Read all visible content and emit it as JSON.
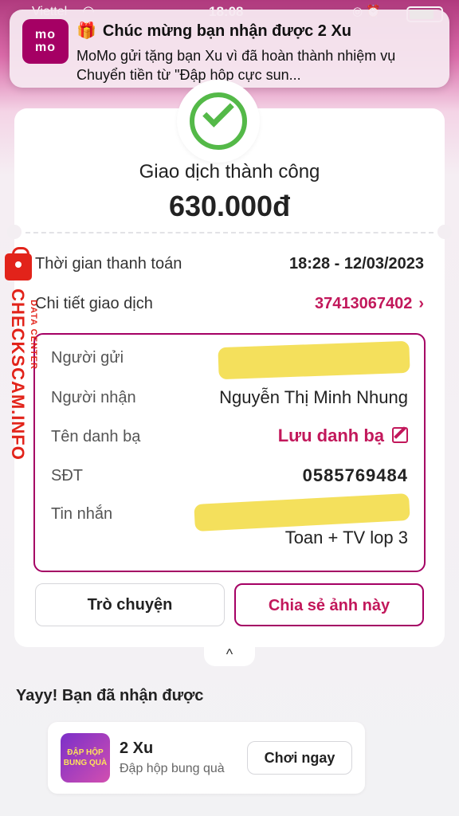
{
  "status_bar": {
    "carrier": "Viettel",
    "time": "18:08",
    "battery": "18"
  },
  "notification": {
    "app_logo_text": "mo\nmo",
    "title": "Chúc mừng bạn nhận được 2 Xu",
    "body": "MoMo gửi tặng bạn Xu vì đã hoàn thành nhiệm vụ Chuyển tiền từ \"Đập hộp cực sun..."
  },
  "transaction": {
    "status": "Giao dịch thành công",
    "amount": "630.000đ",
    "time_label": "Thời gian thanh toán",
    "time_value": "18:28 - 12/03/2023",
    "detail_label": "Chi tiết giao dịch",
    "detail_value": "37413067402"
  },
  "details": {
    "sender_label": "Người gửi",
    "receiver_label": "Người nhận",
    "receiver_value": "Nguyễn Thị Minh Nhung",
    "contact_label": "Tên danh bạ",
    "contact_value": "Lưu danh bạ",
    "phone_label": "SĐT",
    "phone_value": "0585769484",
    "message_label": "Tin nhắn",
    "message_value": "Toan + TV lop 3"
  },
  "actions": {
    "chat": "Trò chuyện",
    "share": "Chia sẻ ảnh này"
  },
  "reward": {
    "title": "Yayy! Bạn đã nhận được",
    "amount": "2 Xu",
    "desc": "Đập hộp bung quà",
    "thumb_text": "ĐẬP HỘP BUNG QUÀ",
    "play": "Chơi ngay"
  },
  "watermark": {
    "main": "CHECKSCAM.INFO",
    "sub": "DATA CENTER"
  },
  "colors": {
    "brand": "#a50064",
    "accent": "#c2185b",
    "success": "#54b948"
  }
}
